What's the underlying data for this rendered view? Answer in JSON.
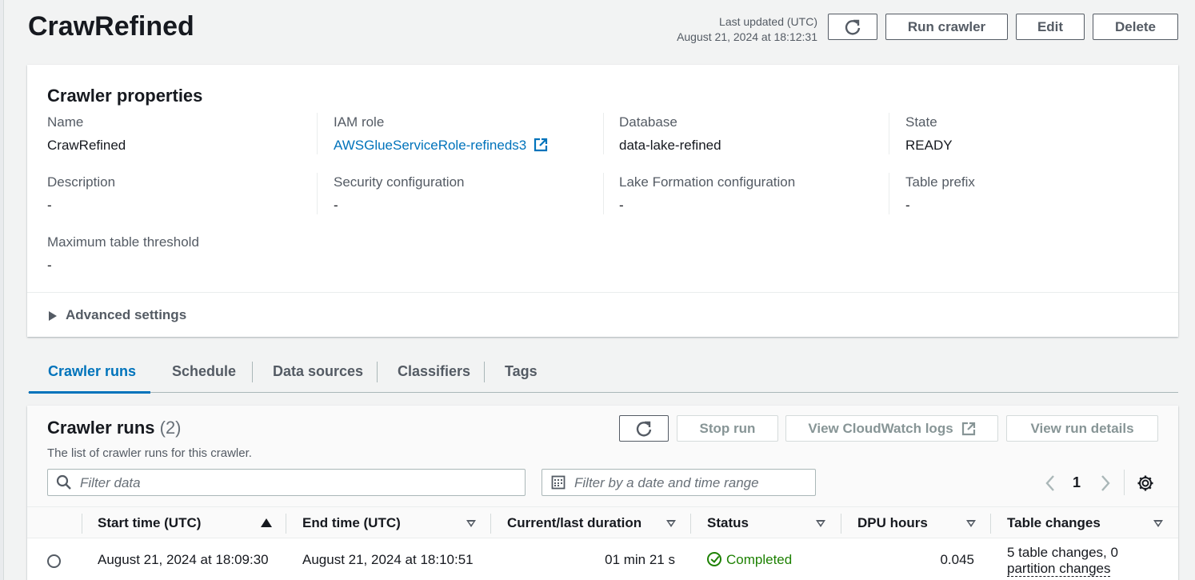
{
  "header": {
    "title": "CrawRefined",
    "last_updated_label": "Last updated (UTC)",
    "last_updated_value": "August 21, 2024 at 18:12:31",
    "buttons": {
      "run_crawler": "Run crawler",
      "edit": "Edit",
      "delete": "Delete"
    }
  },
  "properties": {
    "heading": "Crawler properties",
    "name": {
      "label": "Name",
      "value": "CrawRefined"
    },
    "iam_role": {
      "label": "IAM role",
      "value": "AWSGlueServiceRole-refineds3"
    },
    "database": {
      "label": "Database",
      "value": "data-lake-refined"
    },
    "state": {
      "label": "State",
      "value": "READY"
    },
    "description": {
      "label": "Description",
      "value": "-"
    },
    "security_configuration": {
      "label": "Security configuration",
      "value": "-"
    },
    "lake_formation": {
      "label": "Lake Formation configuration",
      "value": "-"
    },
    "table_prefix": {
      "label": "Table prefix",
      "value": "-"
    },
    "max_table_threshold": {
      "label": "Maximum table threshold",
      "value": "-"
    },
    "advanced_settings": "Advanced settings"
  },
  "tabs": [
    {
      "label": "Crawler runs",
      "active": true
    },
    {
      "label": "Schedule"
    },
    {
      "label": "Data sources"
    },
    {
      "label": "Classifiers"
    },
    {
      "label": "Tags"
    }
  ],
  "runs": {
    "title": "Crawler runs",
    "count": "(2)",
    "description": "The list of crawler runs for this crawler.",
    "buttons": {
      "stop_run": "Stop run",
      "view_cloudwatch": "View CloudWatch logs",
      "view_details": "View run details"
    },
    "filter_placeholder": "Filter data",
    "date_filter_placeholder": "Filter by a date and time range",
    "page": "1",
    "columns": [
      "Start time (UTC)",
      "End time (UTC)",
      "Current/last duration",
      "Status",
      "DPU hours",
      "Table changes"
    ],
    "rows": [
      {
        "start": "August 21, 2024 at 18:09:30",
        "end": "August 21, 2024 at 18:10:51",
        "duration": "01 min 21 s",
        "status": "Completed",
        "dpu": "0.045",
        "changes_line1": "5 table changes, 0",
        "changes_line2": "partition changes"
      }
    ]
  },
  "colors": {
    "link": "#0073bb",
    "success": "#1d8102",
    "text": "#16191f",
    "muted": "#545b64"
  }
}
